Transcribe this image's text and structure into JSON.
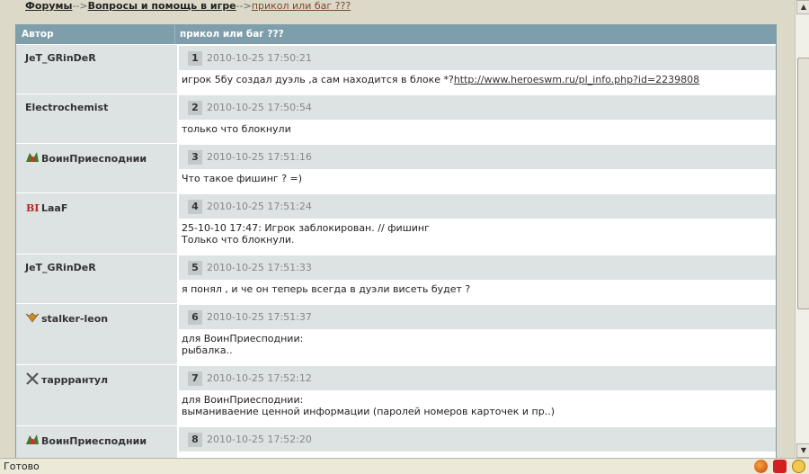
{
  "breadcrumb": {
    "forums": "Форумы",
    "sep1": "-->",
    "section": "Вопросы и помощь в игре",
    "sep2": "-->",
    "current": "прикол или баг ???"
  },
  "table": {
    "col_author": "Автор",
    "col_topic": "прикол или баг ???"
  },
  "posts": [
    {
      "num": "1",
      "author": "JeT_GRinDeR",
      "date": "2010-10-25 17:50:21",
      "lines": [
        "игрок 5бу создал дуэль ,а сам находится в блоке *?"
      ],
      "link": "http://www.heroeswm.ru/pl_info.php?id=2239808"
    },
    {
      "num": "2",
      "author": "Electrochemist",
      "date": "2010-10-25 17:50:54",
      "lines": [
        "только что блокнули"
      ]
    },
    {
      "num": "3",
      "author": "ВоинПриесподнии",
      "date": "2010-10-25 17:51:16",
      "lines": [
        "Что такое фишинг ? =)"
      ],
      "icon": "guild-icon"
    },
    {
      "num": "4",
      "author": "LaaF",
      "date": "2010-10-25 17:51:24",
      "lines": [
        "25-10-10 17:47: Игрок заблокирован. // фишинг",
        "Только что блокнули."
      ],
      "icon": "clan-icon"
    },
    {
      "num": "5",
      "author": "JeT_GRinDeR",
      "date": "2010-10-25 17:51:33",
      "lines": [
        "я понял , и че он теперь всегда в дуэли висеть будет ?"
      ]
    },
    {
      "num": "6",
      "author": "stalker-leon",
      "date": "2010-10-25 17:51:37",
      "lines": [
        "для ВоинПриесподнии:",
        "рыбалка.."
      ],
      "icon": "wings-icon"
    },
    {
      "num": "7",
      "author": "тарррантул",
      "date": "2010-10-25 17:52:12",
      "lines": [
        "для ВоинПриесподнии:",
        "выманиваение ценной информации (паролей номеров карточек и пр..)"
      ],
      "icon": "swords-icon"
    },
    {
      "num": "8",
      "author": "ВоинПриесподнии",
      "date": "2010-10-25 17:52:20",
      "lines": [
        ""
      ],
      "icon": "guild-icon"
    }
  ],
  "status": {
    "text": "Готово"
  }
}
